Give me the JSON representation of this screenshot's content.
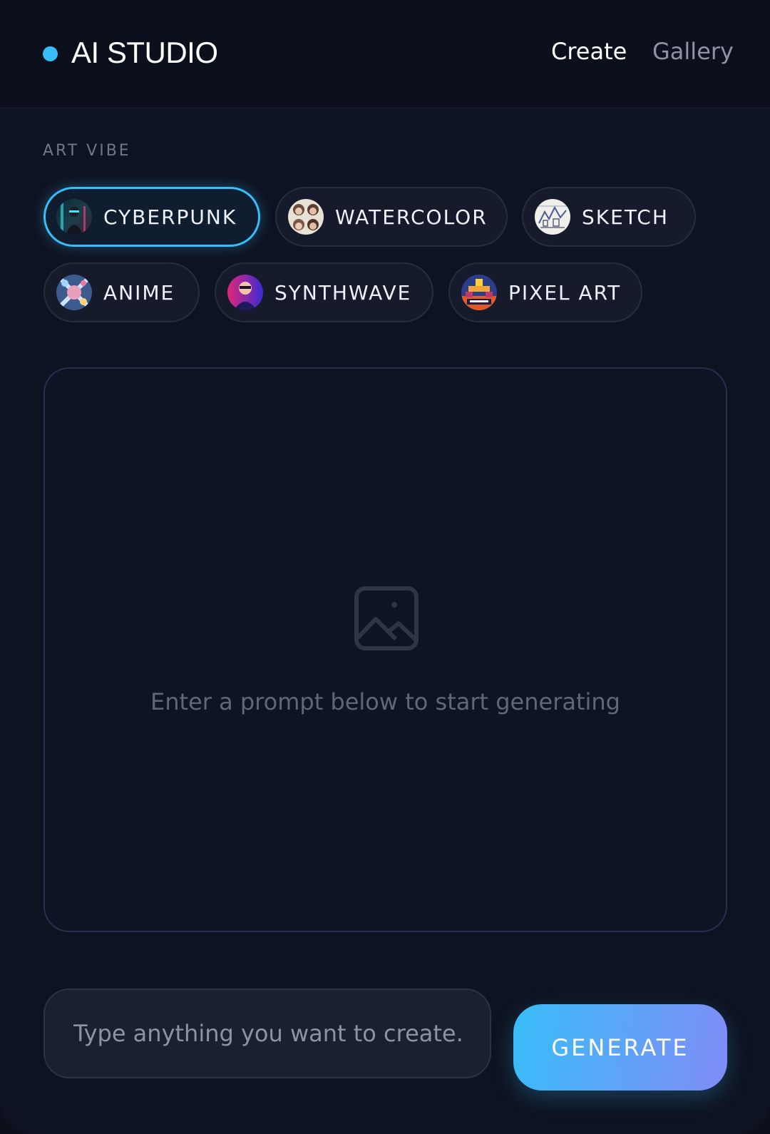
{
  "header": {
    "brand_title": "AI STUDIO",
    "brand_dot_color": "#38bdf8",
    "nav": [
      {
        "label": "Create",
        "active": true
      },
      {
        "label": "Gallery",
        "active": false
      }
    ]
  },
  "art_vibe": {
    "label": "ART VIBE",
    "selected": "CYBERPUNK",
    "styles": [
      {
        "label": "CYBERPUNK",
        "icon": "cyberpunk-thumbnail",
        "active": true
      },
      {
        "label": "WATERCOLOR",
        "icon": "watercolor-thumbnail",
        "active": false
      },
      {
        "label": "SKETCH",
        "icon": "sketch-thumbnail",
        "active": false
      },
      {
        "label": "ANIME",
        "icon": "anime-thumbnail",
        "active": false
      },
      {
        "label": "SYNTHWAVE",
        "icon": "synthwave-thumbnail",
        "active": false
      },
      {
        "label": "PIXEL ART",
        "icon": "pixel-art-thumbnail",
        "active": false
      }
    ],
    "accent_color": "#38bdf8"
  },
  "preview": {
    "icon": "image-placeholder-icon",
    "hint": "Enter a prompt below to start generating"
  },
  "prompt": {
    "value": "",
    "placeholder": "Type anything you want to create..."
  },
  "generate": {
    "label": "GENERATE",
    "gradient": [
      "#38bdf8",
      "#818cf8"
    ]
  }
}
